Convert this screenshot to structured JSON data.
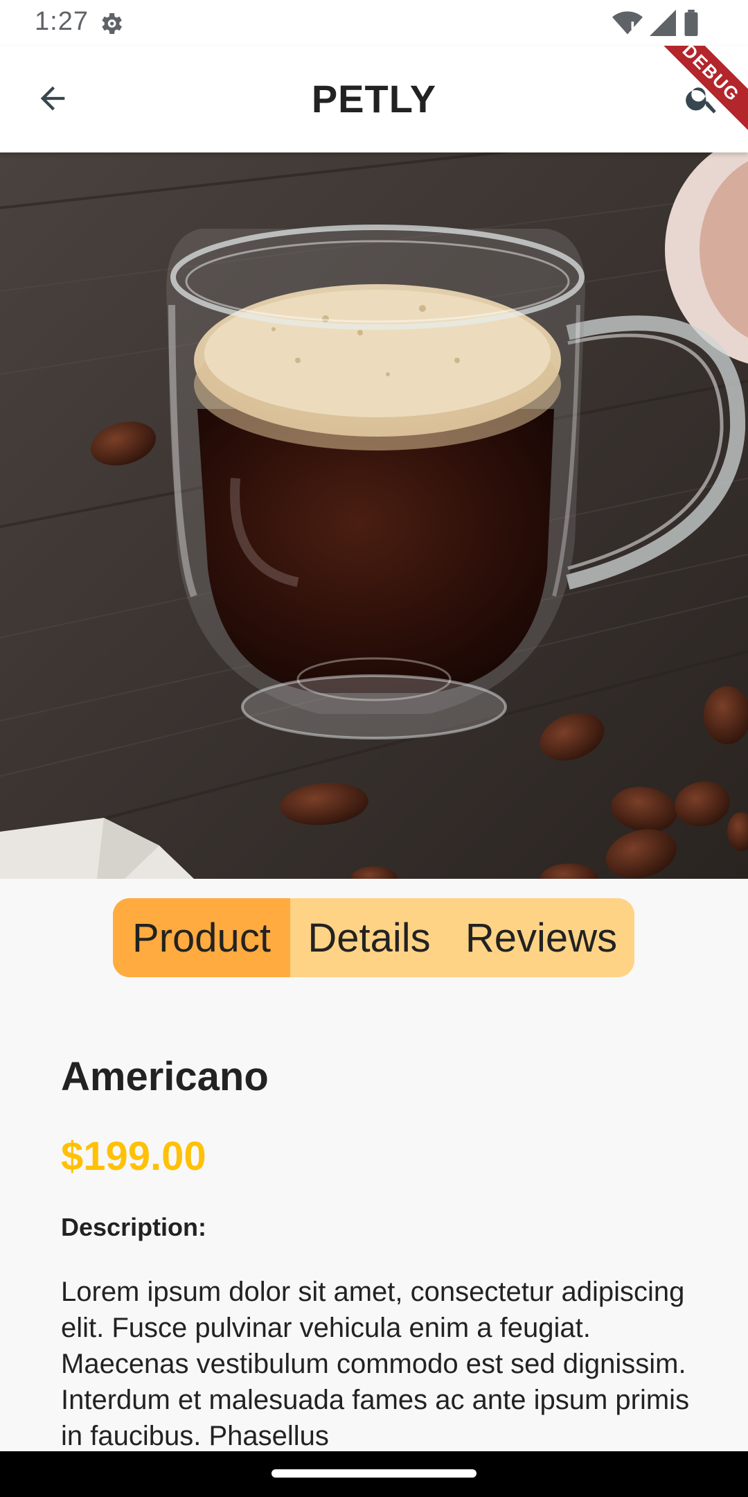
{
  "status_bar": {
    "time": "1:27",
    "icons": [
      "settings-gear-icon",
      "wifi-icon",
      "signal-icon",
      "battery-icon"
    ]
  },
  "app_bar": {
    "title": "PETLY",
    "back_icon": "arrow-back-icon",
    "search_icon": "search-icon",
    "debug_banner": "DEBUG"
  },
  "hero": {
    "image": "americano-glass-mug-photo",
    "accent_colors": [
      "#3b3330",
      "#2a1410",
      "#e6d5b8"
    ]
  },
  "tabs": [
    {
      "label": "Product",
      "active": true
    },
    {
      "label": "Details",
      "active": false
    },
    {
      "label": "Reviews",
      "active": false
    }
  ],
  "product": {
    "name": "Americano",
    "price": "$199.00",
    "description_label": "Description:",
    "description": "Lorem ipsum dolor sit amet, consectetur adipiscing elit. Fusce pulvinar vehicula enim a feugiat. Maecenas vestibulum commodo est sed dignissim. Interdum et malesuada fames ac ante ipsum primis in faucibus. Phasellus"
  },
  "colors": {
    "tab_active": "#ffab3f",
    "tab_inactive": "#ffd385",
    "price": "#ffc107",
    "debug_ribbon": "#b3262b"
  }
}
